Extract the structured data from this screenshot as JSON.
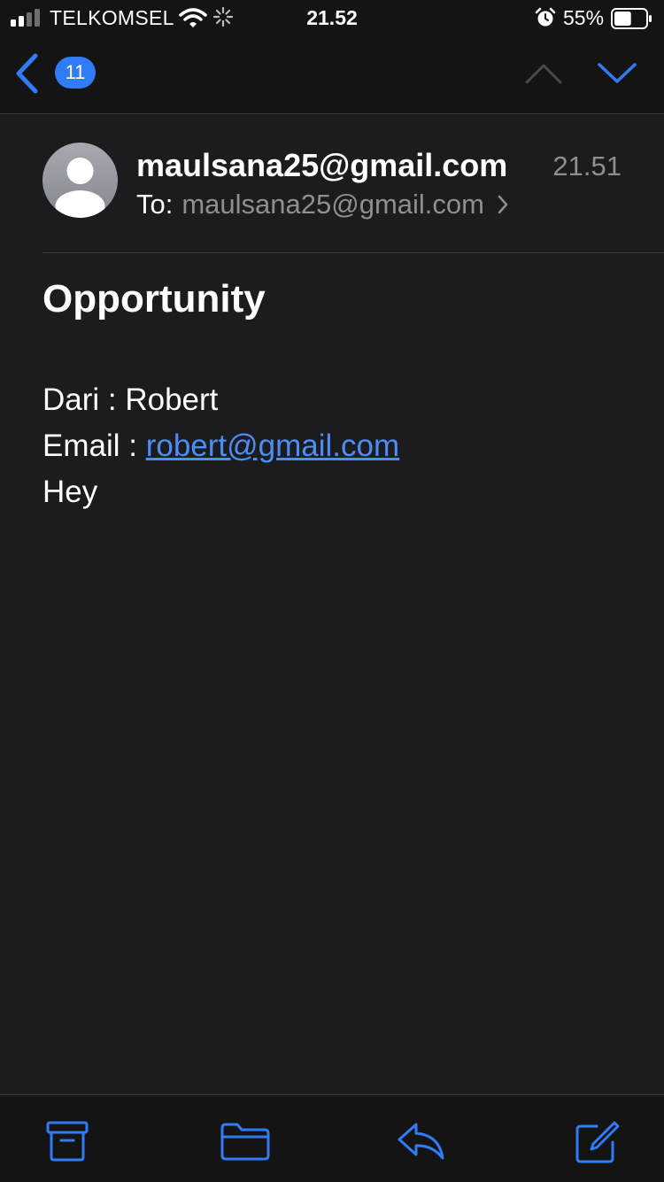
{
  "status_bar": {
    "carrier": "TELKOMSEL",
    "time": "21.52",
    "battery_percent": "55%",
    "battery_level": 0.55,
    "signal_bars_filled": 2,
    "signal_bars_total": 4
  },
  "nav": {
    "unread_count": "11",
    "icons": [
      "back-chevron-icon",
      "chevron-up-icon",
      "chevron-down-icon"
    ]
  },
  "message": {
    "from": "maulsana25@gmail.com",
    "time": "21.51",
    "to_label": "To:",
    "to_address": "maulsana25@gmail.com",
    "subject": "Opportunity",
    "body": {
      "from_line": "Dari : Robert",
      "email_prefix": "Email : ",
      "email_link": "robert@gmail.com",
      "text": "Hey"
    }
  },
  "toolbar": {
    "icons": [
      "archive-icon",
      "folder-icon",
      "reply-icon",
      "compose-icon"
    ]
  },
  "colors": {
    "background": "#1c1c1e",
    "bar_background": "#141414",
    "accent": "#2f7cf6",
    "link": "#4b8ef5",
    "secondary_text": "#8e8e93"
  }
}
